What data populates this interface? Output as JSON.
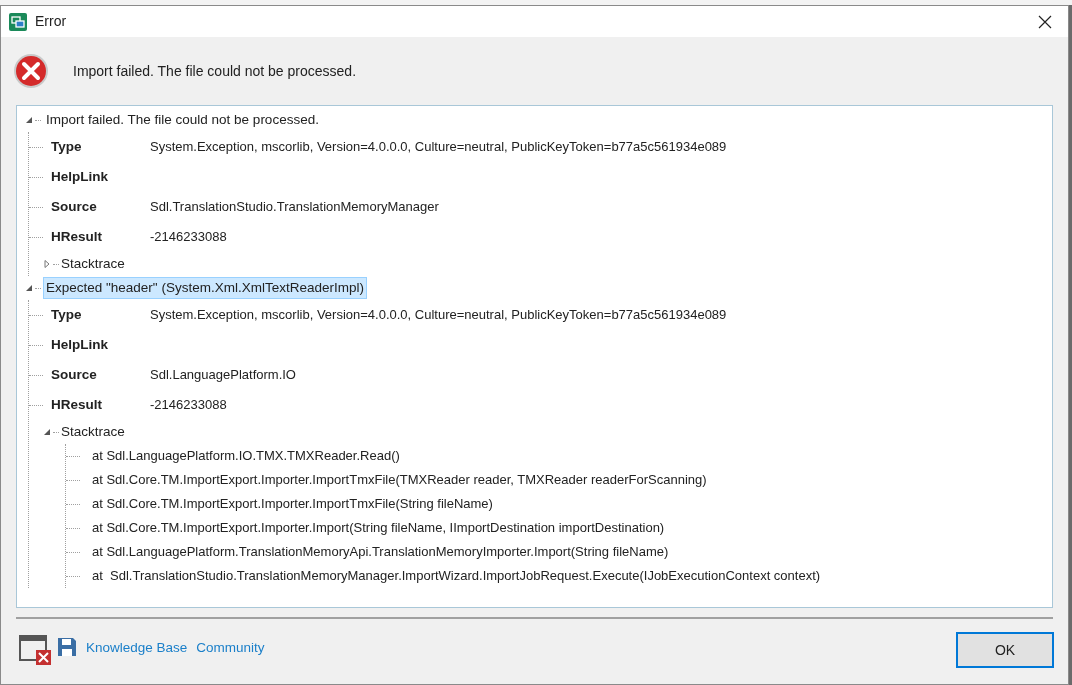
{
  "window": {
    "title": "Error"
  },
  "message": "Import failed. The file could not be processed.",
  "errors": [
    {
      "text": "Import failed. The file could not be processed.",
      "expanded": true,
      "selected": false,
      "properties": [
        {
          "label": "Type",
          "value": "System.Exception, mscorlib, Version=4.0.0.0, Culture=neutral, PublicKeyToken=b77a5c561934e089"
        },
        {
          "label": "HelpLink"
        },
        {
          "label": "Source",
          "value": "Sdl.TranslationStudio.TranslationMemoryManager"
        },
        {
          "label": "HResult",
          "value": "-2146233088"
        }
      ],
      "stacktrace": {
        "label": "Stacktrace",
        "expanded": false
      }
    },
    {
      "text": "Expected \"header\" (System.Xml.XmlTextReaderImpl)",
      "expanded": true,
      "selected": true,
      "properties": [
        {
          "label": "Type",
          "value": "System.Exception, mscorlib, Version=4.0.0.0, Culture=neutral, PublicKeyToken=b77a5c561934e089"
        },
        {
          "label": "HelpLink"
        },
        {
          "label": "Source",
          "value": "Sdl.LanguagePlatform.IO"
        },
        {
          "label": "HResult",
          "value": "-2146233088"
        }
      ],
      "stacktrace": {
        "label": "Stacktrace",
        "expanded": true,
        "lines": [
          "at Sdl.LanguagePlatform.IO.TMX.TMXReader.Read()",
          "at Sdl.Core.TM.ImportExport.Importer.ImportTmxFile(TMXReader reader, TMXReader readerForScanning)",
          "at Sdl.Core.TM.ImportExport.Importer.ImportTmxFile(String fileName)",
          "at Sdl.Core.TM.ImportExport.Importer.Import(String fileName, IImportDestination importDestination)",
          "at Sdl.LanguagePlatform.TranslationMemoryApi.TranslationMemoryImporter.Import(String fileName)",
          "at  Sdl.TranslationStudio.TranslationMemoryManager.ImportWizard.ImportJobRequest.Execute(IJobExecutionContext context)"
        ]
      }
    }
  ],
  "links": [
    "Knowledge Base",
    "Community"
  ],
  "buttons": [
    "OK"
  ]
}
